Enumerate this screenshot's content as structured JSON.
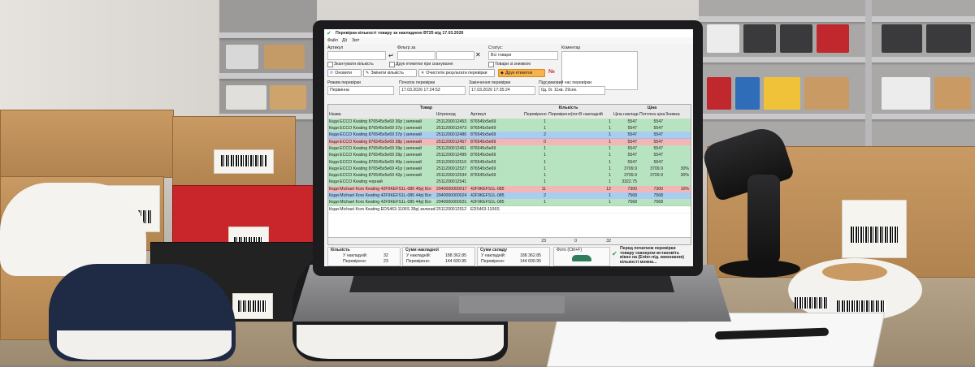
{
  "window": {
    "title": "Перевірка кількості товару за накладною ВТ25 від 17.03.2026"
  },
  "menu": {
    "items": [
      "Файл",
      "Дії",
      "Звіт"
    ]
  },
  "filters": {
    "article_label": "Артикул",
    "filter_label": "Фільтр за",
    "status_label": "Статус:",
    "status_value": "Всі товари",
    "comment_label": "Коментар",
    "check_scanned_qty": "Зкантувати кількість",
    "check_fill_on_scan": "Друк етикетки при скануванні",
    "check_items_with_diff": "Товари зі знижкою"
  },
  "toolbar": {
    "refresh": "Оновити",
    "change_qty": "Змінити кількість",
    "clear_results": "Очистити результати перевірки",
    "print_labels": "Друк етикеток",
    "no_label": "№"
  },
  "meta": {
    "check_mode_label": "Режим перевірки",
    "check_mode_value": "Первинна",
    "start_label": "Початок перевірки",
    "start_value": "17.03.2026 17:24:53",
    "end_label": "Закінчення перевірки",
    "end_value": "17.03.2026 17:35:24",
    "duration_label": "Підсумковий час перевірки",
    "duration_value": "0д. 0г. 11хв. 29сек."
  },
  "table": {
    "group_headers": [
      "Товар",
      "Кількість",
      "Ціна"
    ],
    "columns": [
      "Назва",
      "Штрихкод",
      "Артикул",
      "Перевірено",
      "Перевірено(поточна)",
      "В накладній",
      "Ціна накладна",
      "Поточна ціна",
      "Знижка"
    ],
    "rows": [
      {
        "name": "Кеди ECCO Keating 876545x5e69 36р | зелений",
        "barcode": "2511200012453",
        "article": "876545x5e69",
        "checked": "1",
        "invoice": "1",
        "price": "5547",
        "cur": "5547",
        "disc": "",
        "color": "#b8e3c1"
      },
      {
        "name": "Кеди ECCO Keating 876545x5e69 37р | зелений",
        "barcode": "2511200012473",
        "article": "876545x5e69",
        "checked": "1",
        "invoice": "1",
        "price": "5547",
        "cur": "5547",
        "disc": "",
        "color": "#b8e3c1"
      },
      {
        "name": "Кеди ECCO Keating 876545x5e69 37р | зелений",
        "barcode": "2511200012480",
        "article": "876545x5e69",
        "checked": "2",
        "invoice": "1",
        "price": "5547",
        "cur": "5547",
        "disc": "",
        "color": "#a9cdf0"
      },
      {
        "name": "Кеди ECCO Keating 876545x5e69 38р | зелений",
        "barcode": "2511200012457",
        "article": "876545x5e69",
        "checked": "0",
        "invoice": "1",
        "price": "5547",
        "cur": "5547",
        "disc": "",
        "color": "#f2b6b6"
      },
      {
        "name": "Кеди ECCO Keating 876545x5e69 39р | зелений",
        "barcode": "2511200012461",
        "article": "876545x5e69",
        "checked": "1",
        "invoice": "1",
        "price": "5547",
        "cur": "5547",
        "disc": "",
        "color": "#b8e3c1"
      },
      {
        "name": "Кеди ECCO Keating 876545x5e69 39р | зелений",
        "barcode": "2511200012499",
        "article": "876545x5e69",
        "checked": "1",
        "invoice": "1",
        "price": "5547",
        "cur": "5547",
        "disc": "",
        "color": "#b8e3c1"
      },
      {
        "name": "Кеди ECCO Keating 876545x5e69 40р | зелений",
        "barcode": "2511200012510",
        "article": "876545x5e69",
        "checked": "1",
        "invoice": "1",
        "price": "5547",
        "cur": "5547",
        "disc": "",
        "color": "#b8e3c1"
      },
      {
        "name": "Кеди ECCO Keating 876545x5e69 41р | зелений",
        "barcode": "2511200012527",
        "article": "876545x5e69",
        "checked": "1",
        "invoice": "1",
        "price": "3709.9",
        "cur": "3709.9",
        "disc": "30%",
        "color": "#b8e3c1"
      },
      {
        "name": "Кеди ECCO Keating 876545x5e69 42р | зелений",
        "barcode": "2511200012534",
        "article": "876545x5e69",
        "checked": "1",
        "invoice": "1",
        "price": "3709.9",
        "cur": "3709.9",
        "disc": "30%",
        "color": "#b8e3c1"
      },
      {
        "name": "Кеди ECCO Keating чорний",
        "barcode": "2511200012541",
        "article": "",
        "checked": "1",
        "invoice": "1",
        "price": "3322.75",
        "cur": "",
        "disc": "",
        "color": "#b8e3c1"
      },
      {
        "name": "Кеди Michael Kors Keating 42F9KEFS1L-085 40р| Біл",
        "barcode": "2940000000017",
        "article": "42F9KEFS1L-085",
        "checked": "11",
        "invoice": "12",
        "price": "7300",
        "cur": "7300",
        "disc": "10%",
        "color": "#f2b6b6"
      },
      {
        "name": "Кеди Michael Kors Keating 42F9KEFS1L-085 44р| Біл",
        "barcode": "2940000000024",
        "article": "42F9KEFS1L-085",
        "checked": "2",
        "invoice": "1",
        "price": "7568",
        "cur": "7568",
        "disc": "",
        "color": "#a9cdf0"
      },
      {
        "name": "Кеди Michael Kors Keating 42F9KEFS1L-085 44р| Біл",
        "barcode": "2940000000031",
        "article": "42F9KEFS1L-085",
        "checked": "1",
        "invoice": "1",
        "price": "7568",
        "cur": "7568",
        "disc": "",
        "color": "#b8e3c1"
      },
      {
        "name": "Кеди Michael Kors Keating EDS463-1106S 39р| зелений",
        "barcode": "2511200012912",
        "article": "EDS463-1106S",
        "checked": "",
        "invoice": "",
        "price": "",
        "cur": "",
        "disc": "",
        "color": "#ffffff"
      }
    ],
    "total_checked": "23",
    "total_current": "0",
    "total_invoice": "32"
  },
  "summary": {
    "qty_title": "Кількість",
    "in_invoice_label": "У накладній:",
    "in_invoice_value": "32",
    "checked_label": "Перевірено:",
    "checked_value": "23",
    "diff_label": "Різниця:",
    "diff_value": "9",
    "sum_invoice_title": "Суми накладної",
    "sum_in_invoice": "188 362.85",
    "sum_checked": "144 600.95",
    "sum_diff": "-43 755.90",
    "sum_warehouse_title": "Суми складу",
    "wh_in_invoice": "188 362.85",
    "wh_checked": "144 600.95",
    "wh_diff": "-43 755.90",
    "photo_label": "Фото (Ctrl+F)",
    "notice": "Перед початком перевірки товару сканером встановіть вікно на (Enter-під. виконання) кількості можна..."
  }
}
